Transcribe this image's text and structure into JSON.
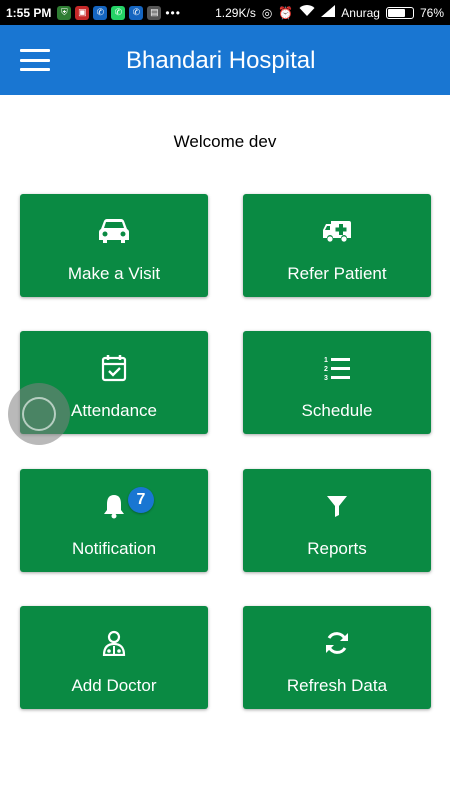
{
  "status_bar": {
    "time": "1:55 PM",
    "speed": "1.29K/s",
    "carrier": "Anurag",
    "battery": "76%",
    "battery_level": 0.76
  },
  "app_bar": {
    "title": "Bhandari Hospital",
    "color": "#1976d2"
  },
  "welcome": "Welcome dev",
  "tile_color": "#0a8a43",
  "tiles": [
    {
      "label": "Make a Visit",
      "icon": "car-icon"
    },
    {
      "label": "Refer Patient",
      "icon": "ambulance-icon"
    },
    {
      "label": "Attendance",
      "icon": "calendar-check-icon"
    },
    {
      "label": "Schedule",
      "icon": "numbered-list-icon"
    },
    {
      "label": "Notification",
      "icon": "bell-icon",
      "badge": "7"
    },
    {
      "label": "Reports",
      "icon": "filter-icon"
    },
    {
      "label": "Add Doctor",
      "icon": "doctor-icon"
    },
    {
      "label": "Refresh Data",
      "icon": "refresh-icon"
    }
  ]
}
